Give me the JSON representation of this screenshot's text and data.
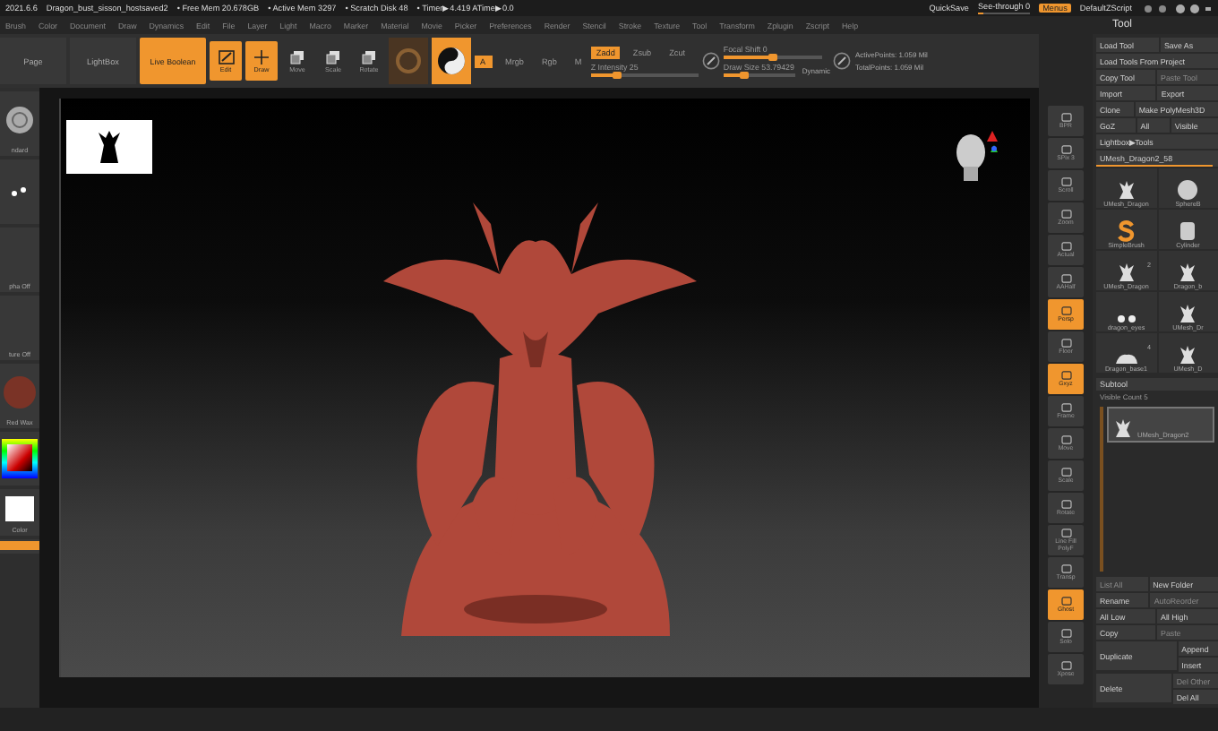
{
  "title_bar": {
    "texts": [
      "2021.6.6",
      "Dragon_bust_sisson_hostsaved2",
      "• Free Mem 20.678GB",
      "• Active Mem 3297",
      "• Scratch Disk 48",
      "• Timer▶4.419 ATime▶0.0"
    ],
    "quicksave": "QuickSave",
    "see_through": {
      "label": "See-through 0",
      "level": 0.05
    },
    "menus": {
      "label": "Menus",
      "on": true
    },
    "script": "DefaultZScript"
  },
  "menu_bar": [
    "Brush",
    "Color",
    "Document",
    "Draw",
    "Dynamics",
    "Edit",
    "File",
    "Layer",
    "Light",
    "Macro",
    "Marker",
    "Material",
    "Movie",
    "Picker",
    "Preferences",
    "Render",
    "Stencil",
    "Stroke",
    "Texture",
    "Tool",
    "Transform",
    "Zplugin",
    "Zscript",
    "Help"
  ],
  "toolbar": [
    {
      "kind": "tab",
      "label": "Page"
    },
    {
      "kind": "tab",
      "label": "LightBox"
    },
    {
      "kind": "wide",
      "label": "Live Boolean",
      "on": true
    },
    {
      "kind": "edit",
      "label": "Edit",
      "on": true
    },
    {
      "kind": "draw",
      "label": "Draw",
      "on": true
    },
    {
      "kind": "transform",
      "label": "Move",
      "on": false
    },
    {
      "kind": "transform",
      "label": "Scale",
      "on": false
    },
    {
      "kind": "transform",
      "label": "Rotate",
      "on": false
    },
    {
      "kind": "material",
      "on": false
    },
    {
      "kind": "material",
      "on": true
    }
  ],
  "color_modes": [
    {
      "label": "A",
      "on": true
    },
    {
      "label": "Mrgb",
      "on": false
    },
    {
      "label": "Rgb",
      "on": false
    },
    {
      "label": "M",
      "on": false
    }
  ],
  "depth_modes": [
    {
      "label": "Zadd",
      "on": true
    },
    {
      "label": "Zsub",
      "on": false
    },
    {
      "label": "Zcut",
      "on": false
    }
  ],
  "z_intensity": {
    "label": "Z Intensity 25",
    "level": 0.25
  },
  "focal_shift": {
    "label": "Focal Shift 0",
    "level": 0.5
  },
  "draw_size": {
    "label": "Draw Size 53.79429",
    "level": 0.3
  },
  "dynamic": "Dynamic",
  "points": [
    "ActivePoints: 1.059 Mil",
    "TotalPoints: 1.059 Mil"
  ],
  "left_panel": [
    {
      "kind": "brush",
      "label": "ndard"
    },
    {
      "kind": "stroke"
    },
    {
      "kind": "alpha",
      "label": "pha Off"
    },
    {
      "kind": "texture",
      "label": "ture Off"
    },
    {
      "kind": "material",
      "label": "Red Wax"
    },
    {
      "kind": "picker"
    },
    {
      "kind": "swatch",
      "label": "Color"
    },
    {
      "kind": "button"
    }
  ],
  "shelf": [
    {
      "label": "BPR",
      "on": false
    },
    {
      "label": "SPix 3",
      "on": false
    },
    {
      "label": "Scroll",
      "on": false
    },
    {
      "label": "Zoom",
      "on": false
    },
    {
      "label": "Actual",
      "on": false
    },
    {
      "label": "AAHalf",
      "on": false
    },
    {
      "label": "Persp",
      "on": true
    },
    {
      "label": "Floor",
      "on": false
    },
    {
      "label": "Gxyz",
      "on": true
    },
    {
      "label": "Frame",
      "on": false
    },
    {
      "label": "Move",
      "on": false
    },
    {
      "label": "Scale",
      "on": false
    },
    {
      "label": "Rotate",
      "on": false
    },
    {
      "label": "Line Fill PolyF",
      "on": false
    },
    {
      "label": "Transp",
      "on": false
    },
    {
      "label": "Ghost",
      "on": true
    },
    {
      "label": "Solo",
      "on": false
    },
    {
      "label": "Xpose",
      "on": false
    }
  ],
  "tool_panel": {
    "title": "Tool",
    "rows": [
      [
        {
          "label": "Load Tool",
          "disabled": false
        },
        {
          "label": "Save As",
          "disabled": false
        }
      ],
      [
        {
          "label": "Load Tools From Project",
          "disabled": false
        }
      ],
      [
        {
          "label": "Copy Tool",
          "disabled": false
        },
        {
          "label": "Paste Tool",
          "disabled": true
        }
      ],
      [
        {
          "label": "Import",
          "disabled": false
        },
        {
          "label": "Export",
          "disabled": false
        }
      ],
      [
        {
          "label": "Clone",
          "disabled": false
        },
        {
          "label": "Make PolyMesh3D",
          "disabled": false
        }
      ],
      [
        {
          "label": "GoZ",
          "disabled": false
        },
        {
          "label": "All",
          "disabled": false
        },
        {
          "label": "Visible",
          "disabled": false
        }
      ],
      [
        {
          "label": "Lightbox▶Tools",
          "disabled": false
        }
      ]
    ],
    "current": {
      "label": "UMesh_Dragon2_58",
      "level": 0.95
    },
    "thumbs": [
      {
        "label": "UMesh_Dragon",
        "kind": "dragon"
      },
      {
        "label": "SphereB",
        "kind": "sphere"
      },
      {
        "label": "SimpleBrush",
        "kind": "simple"
      },
      {
        "label": "Cylinder",
        "kind": "cylinder"
      },
      {
        "label": "UMesh_Dragon",
        "kind": "dragon",
        "count": "2"
      },
      {
        "label": "Dragon_b",
        "kind": "dragon"
      },
      {
        "label": "dragon_eyes",
        "kind": "eyes"
      },
      {
        "label": "UMesh_Dr",
        "kind": "dragon"
      },
      {
        "label": "Dragon_base1",
        "kind": "base",
        "count": "4"
      },
      {
        "label": "UMesh_D",
        "kind": "dragon"
      }
    ],
    "subtool": {
      "title": "Subtool",
      "visible_count": "Visible Count 5",
      "items": [
        {
          "label": "UMesh_Dragon2",
          "selected": true
        }
      ]
    },
    "list_row": [
      {
        "label": "List All",
        "disabled": true
      },
      {
        "label": "New Folder",
        "disabled": false
      }
    ],
    "action_rows": [
      [
        {
          "label": "Rename",
          "disabled": false
        },
        {
          "label": "AutoReorder",
          "disabled": true
        }
      ],
      [
        {
          "label": "All Low",
          "disabled": false
        },
        {
          "label": "All High",
          "disabled": false
        }
      ],
      [
        {
          "label": "Copy",
          "disabled": false
        },
        {
          "label": "Paste",
          "disabled": true
        }
      ],
      [
        {
          "label": "Duplicate",
          "disabled": false
        },
        {
          "label": "Append",
          "disabled": false
        },
        {
          "label": "Insert",
          "disabled": false
        }
      ],
      [
        {
          "label": "Delete",
          "disabled": false
        },
        {
          "label": "Del Other",
          "disabled": true
        },
        {
          "label": "Del All",
          "disabled": false
        }
      ]
    ]
  }
}
